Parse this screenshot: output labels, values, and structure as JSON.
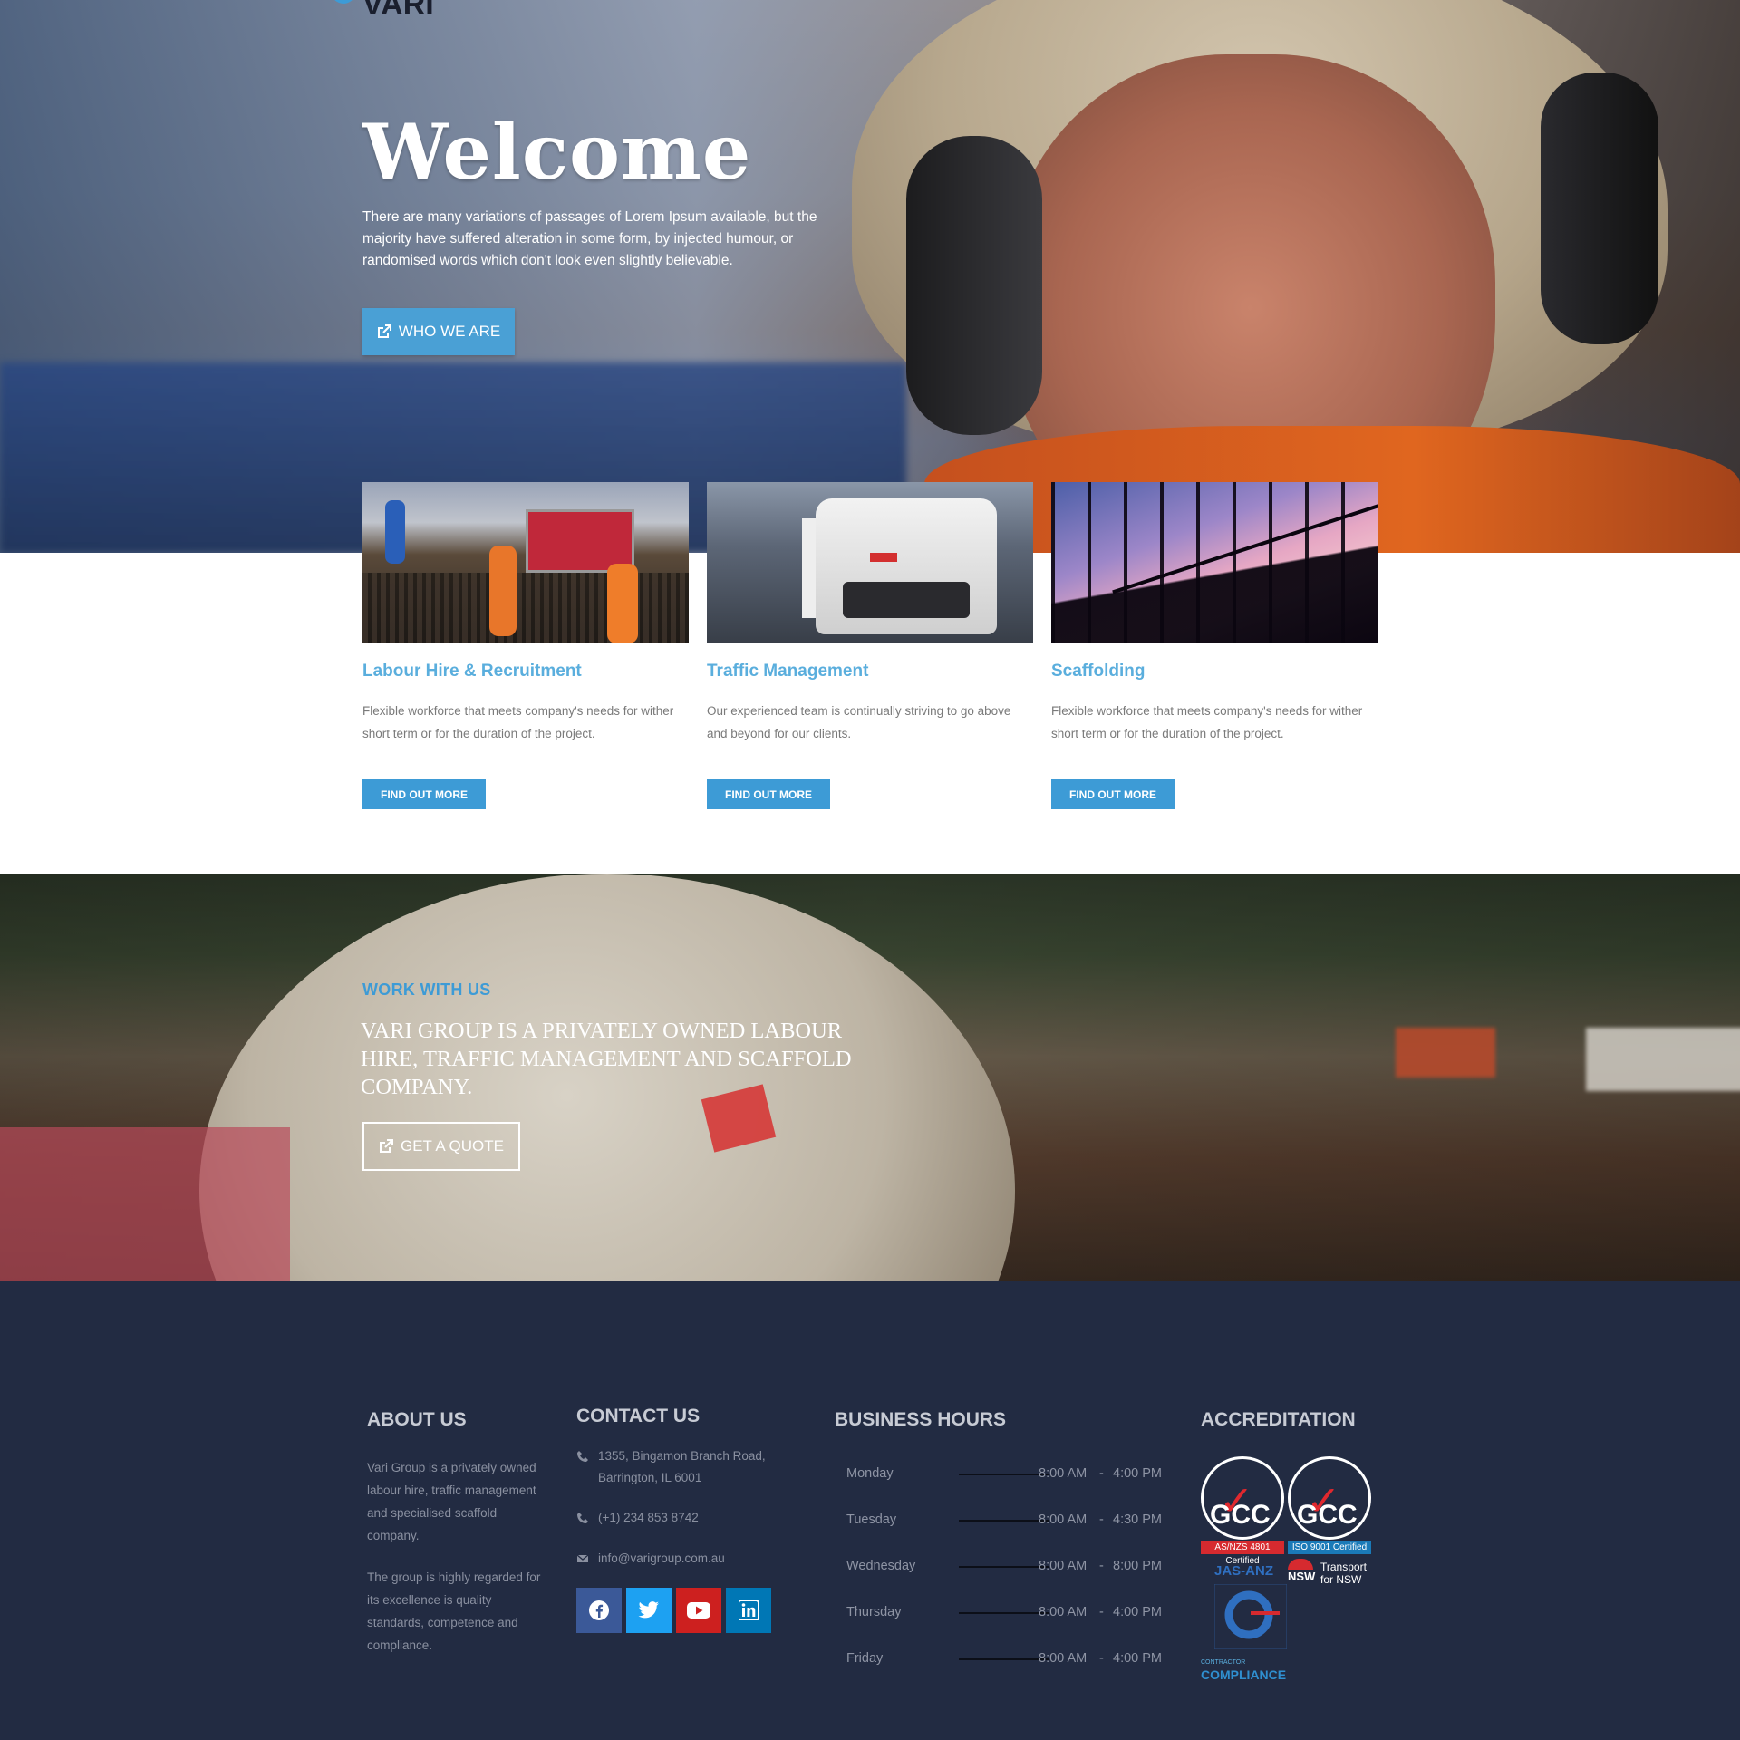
{
  "header": {
    "logo_fragment": "VARI"
  },
  "hero": {
    "title": "Welcome",
    "intro": "There are many variations of passages of Lorem Ipsum available, but the majority have suffered alteration in some form, by injected humour, or randomised words which don't look even slightly believable.",
    "cta_label": "WHO WE ARE"
  },
  "services": [
    {
      "title": "Labour Hire & Recruitment",
      "description": "Flexible workforce that meets company's needs for wither short term or for the duration of the project.",
      "button": "FIND OUT MORE"
    },
    {
      "title": "Traffic Management",
      "description": "Our experienced team is continually striving to go above and beyond for our clients.",
      "button": "FIND OUT MORE"
    },
    {
      "title": "Scaffolding",
      "description": "Flexible workforce that meets company's needs for wither short term or for the duration of the project.",
      "button": "FIND OUT MORE"
    }
  ],
  "work": {
    "eyebrow": "WORK WITH US",
    "headline": "VARI GROUP IS A PRIVATELY OWNED LABOUR HIRE, TRAFFIC MANAGEMENT AND SCAFFOLD COMPANY.",
    "cta_label": "GET A QUOTE"
  },
  "footer": {
    "about": {
      "heading": "ABOUT US",
      "p1": "Vari Group is a privately owned labour hire, traffic management and specialised scaffold company.",
      "p2": "The group is highly regarded for its excellence is quality standards, competence and compliance."
    },
    "contact": {
      "heading": "CONTACT US",
      "address": "1355, Bingamon Branch Road, Barrington, IL 6001",
      "phone": "(+1) 234 853 8742",
      "email": "info@varigroup.com.au",
      "socials": [
        {
          "name": "facebook-icon",
          "color": "#3b5998"
        },
        {
          "name": "twitter-icon",
          "color": "#1da1f2"
        },
        {
          "name": "youtube-icon",
          "color": "#cd201f"
        },
        {
          "name": "linkedin-icon",
          "color": "#0077b5"
        }
      ]
    },
    "hours": {
      "heading": "BUSINESS HOURS",
      "rows": [
        {
          "day": "Monday",
          "open": "8:00 AM",
          "close": "4:00 PM"
        },
        {
          "day": "Tuesday",
          "open": "8:00 AM",
          "close": "4:30 PM"
        },
        {
          "day": "Wednesday",
          "open": "8:00 AM",
          "close": "8:00 PM"
        },
        {
          "day": "Thursday",
          "open": "8:00 AM",
          "close": "4:00 PM"
        },
        {
          "day": "Friday",
          "open": "8:00 AM",
          "close": "4:00 PM"
        }
      ]
    },
    "accreditation": {
      "heading": "ACCREDITATION",
      "gcc_text": "GCC",
      "gcc1_band": "AS/NZS 4801 Certified",
      "gcc2_band": "ISO 9001 Certified",
      "jasanz": "JAS-ANZ",
      "nsw_short": "NSW",
      "nsw_line1": "Transport",
      "nsw_line2": "for NSW",
      "compliance_small": "CONTRACTOR",
      "compliance": "COMPLIANCE"
    }
  },
  "colors": {
    "accent": "#3d9bd6",
    "footer_bg": "#222b42",
    "title_blue": "#5aaedd"
  }
}
